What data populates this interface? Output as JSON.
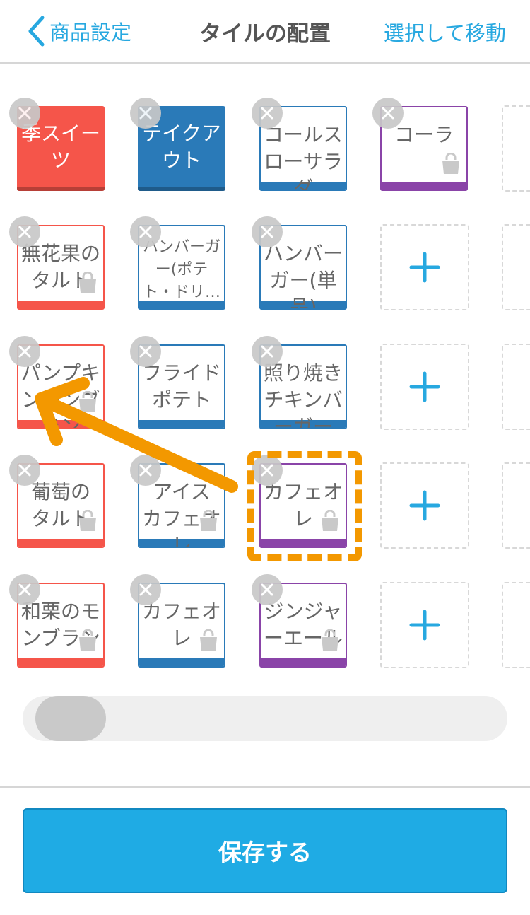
{
  "header": {
    "back_label": "商品設定",
    "title": "タイルの配置",
    "right_action": "選択して移動"
  },
  "colors": {
    "accent": "#27a8e0",
    "red": "#f5554a",
    "blue": "#2a7ab8",
    "purple": "#8a44a8",
    "highlight": "#f39800"
  },
  "tiles": [
    {
      "label": "季スイーツ",
      "lines": [
        "季スイー",
        "ツ"
      ],
      "style": "solid",
      "color": "red"
    },
    {
      "label": "テイクアウト",
      "lines": [
        "テイクア",
        "ウト"
      ],
      "style": "solid",
      "color": "blue"
    },
    {
      "label": "コールスローサラダ",
      "lines": [
        "コールス",
        "ローサラ",
        "ダ"
      ],
      "style": "outline",
      "color": "blue"
    },
    {
      "label": "コーラ",
      "lines": [
        "コーラ"
      ],
      "style": "outline",
      "color": "purple",
      "bag": true
    },
    {
      "label": "無花果のタルト",
      "lines": [
        "無花果の",
        "タルト"
      ],
      "style": "outline",
      "color": "red",
      "bag": true
    },
    {
      "label": "ハンバーガー(ポテト・ドリ…",
      "lines": [
        "ハンバーガ",
        "ー(ポテ",
        "ト・ドリ…"
      ],
      "style": "outline",
      "color": "blue",
      "small": true
    },
    {
      "label": "ハンバーガー(単品)",
      "lines": [
        "ハンバー",
        "ガー(単",
        "品)"
      ],
      "style": "outline",
      "color": "blue"
    },
    {
      "label": "パンプキンモンブラン",
      "lines": [
        "パンプキ",
        "ンモンブ",
        "ラン"
      ],
      "style": "outline",
      "color": "red",
      "bag": true
    },
    {
      "label": "フライドポテト",
      "lines": [
        "フライド",
        "ポテト"
      ],
      "style": "outline",
      "color": "blue"
    },
    {
      "label": "照り焼きチキンバーガー",
      "lines": [
        "照り焼き",
        "チキンバ",
        "ーガー"
      ],
      "style": "outline",
      "color": "blue"
    },
    {
      "label": "葡萄のタルト",
      "lines": [
        "葡萄の",
        "タルト"
      ],
      "style": "outline",
      "color": "red",
      "bag": true
    },
    {
      "label": "アイスカフェオレ",
      "lines": [
        "アイス",
        "カフェオ",
        "レ"
      ],
      "style": "outline",
      "color": "blue",
      "bag": true
    },
    {
      "label": "カフェオレ",
      "lines": [
        "カフェオ",
        "レ"
      ],
      "style": "outline",
      "color": "purple",
      "bag": true,
      "selected": true
    },
    {
      "label": "和栗のモンブラン",
      "lines": [
        "和栗のモ",
        "ンブラン"
      ],
      "style": "outline",
      "color": "red",
      "bag": true
    },
    {
      "label": "カフェオレ",
      "lines": [
        "カフェオ",
        "レ"
      ],
      "style": "outline",
      "color": "blue",
      "bag": true
    },
    {
      "label": "ジンジャーエール",
      "lines": [
        "ジンジャ",
        "ーエール"
      ],
      "style": "outline",
      "color": "purple",
      "bag": true
    }
  ],
  "add_icon": "plus-icon",
  "scroll_position": 0.0,
  "save_button": "保存する"
}
